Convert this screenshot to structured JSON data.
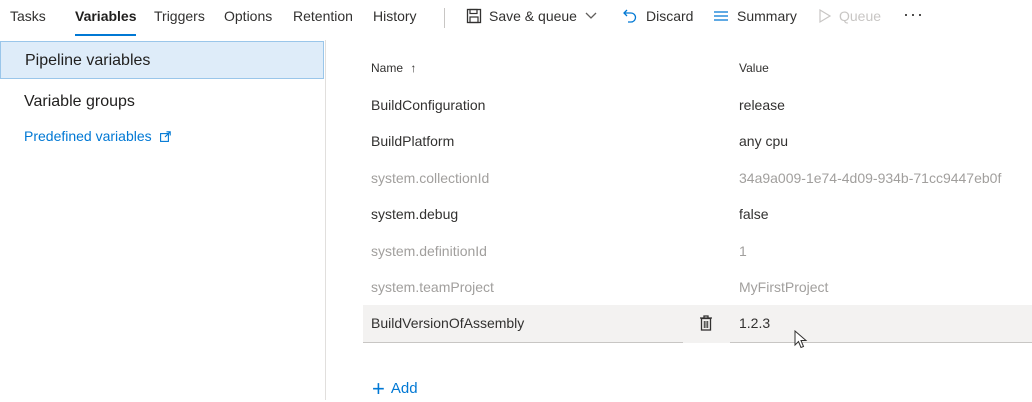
{
  "tabs": [
    "Tasks",
    "Variables",
    "Triggers",
    "Options",
    "Retention",
    "History"
  ],
  "active_tab": "Variables",
  "commands": {
    "save_label": "Save & queue",
    "discard_label": "Discard",
    "summary_label": "Summary",
    "queue_label": "Queue",
    "more_label": "···"
  },
  "nav": {
    "pipeline_variables": "Pipeline variables",
    "variable_groups": "Variable groups",
    "predefined_variables": "Predefined variables"
  },
  "table": {
    "name_header": "Name",
    "sort_indicator": "↑",
    "value_header": "Value",
    "rows": [
      {
        "name": "BuildConfiguration",
        "value": "release",
        "locked": false
      },
      {
        "name": "BuildPlatform",
        "value": "any cpu",
        "locked": false
      },
      {
        "name": "system.collectionId",
        "value": "34a9a009-1e74-4d09-934b-71cc9447eb0f",
        "locked": true
      },
      {
        "name": "system.debug",
        "value": "false",
        "locked": false
      },
      {
        "name": "system.definitionId",
        "value": "1",
        "locked": true
      },
      {
        "name": "system.teamProject",
        "value": "MyFirstProject",
        "locked": true
      },
      {
        "name": "BuildVersionOfAssembly",
        "value": "1.2.3",
        "locked": false
      }
    ]
  },
  "add_label": "Add",
  "icons": {
    "save": "save-icon",
    "discard": "undo-icon",
    "summary": "list-icon",
    "queue": "play-icon",
    "delete": "trash-icon",
    "external": "external-link-icon"
  },
  "colors": {
    "accent": "#0078d4",
    "selected_bg": "#deecf9",
    "locked_text": "#a19f9d"
  }
}
